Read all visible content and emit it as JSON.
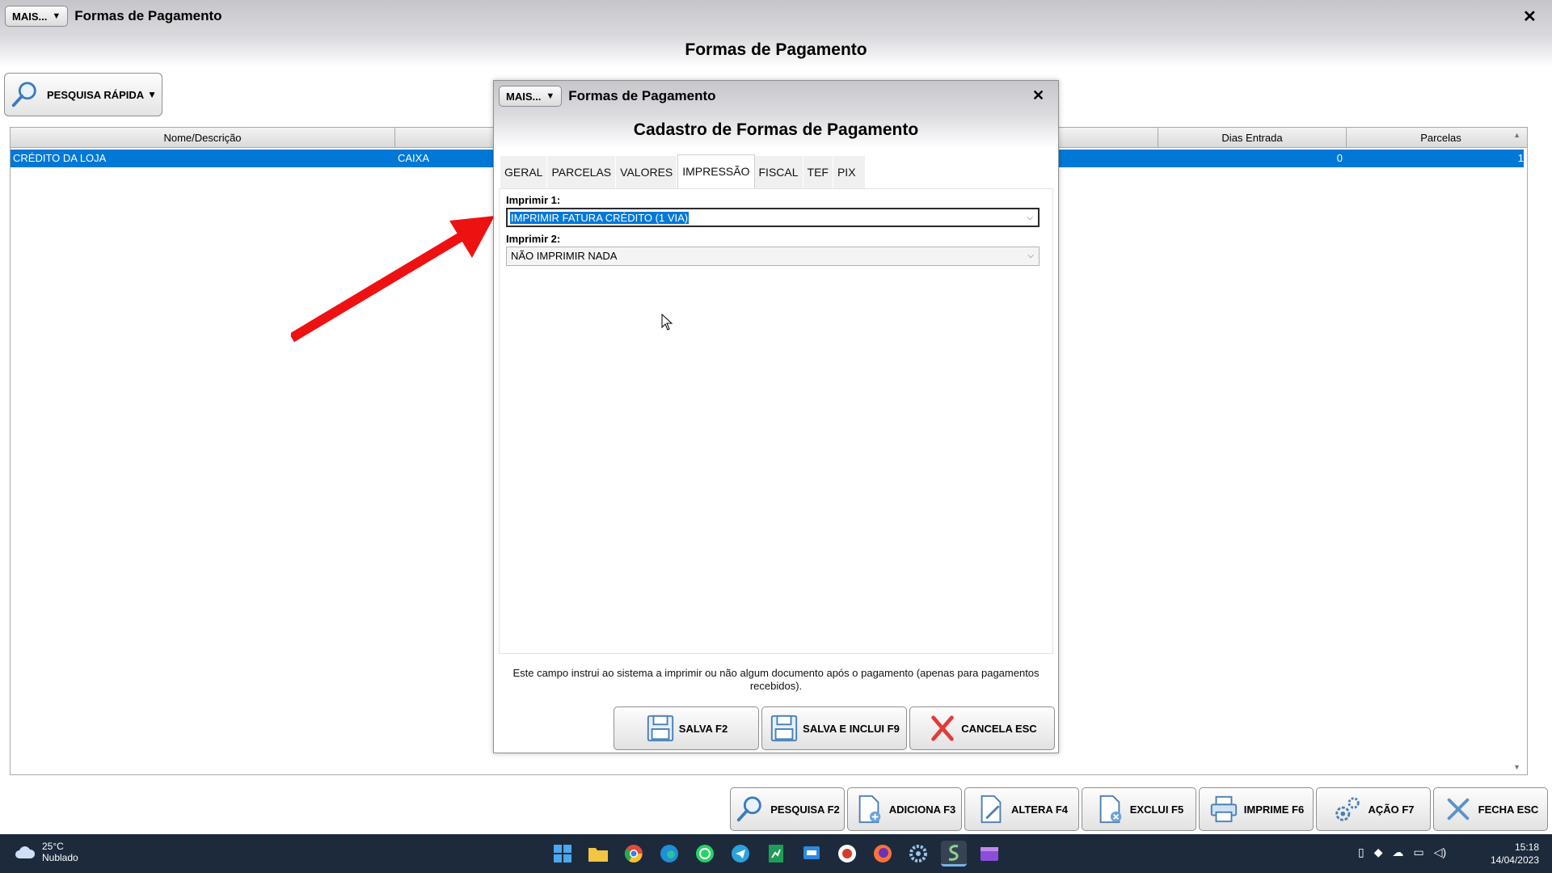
{
  "main_window": {
    "mais_label": "MAIS...",
    "title": "Formas de Pagamento",
    "header": "Formas de Pagamento",
    "quick_search_label": "PESQUISA RÁPIDA"
  },
  "grid": {
    "columns": [
      "Nome/Descrição",
      "",
      "",
      "",
      "",
      "Dias Entrada",
      "Parcelas"
    ],
    "rows": [
      {
        "nome": "CRÉDITO DA LOJA",
        "tipo": "CAIXA",
        "dias_entrada": "0",
        "parcelas": "1"
      }
    ]
  },
  "toolbar": {
    "buttons": [
      {
        "label": "PESQUISA F2",
        "icon": "search-icon"
      },
      {
        "label": "ADICIONA F3",
        "icon": "add-document-icon"
      },
      {
        "label": "ALTERA F4",
        "icon": "edit-document-icon"
      },
      {
        "label": "EXCLUI F5",
        "icon": "delete-document-icon"
      },
      {
        "label": "IMPRIME F6",
        "icon": "printer-icon"
      },
      {
        "label": "AÇÃO F7",
        "icon": "gears-icon"
      },
      {
        "label": "FECHA ESC",
        "icon": "close-icon"
      }
    ]
  },
  "dialog": {
    "mais_label": "MAIS...",
    "title": "Formas de Pagamento",
    "header": "Cadastro de Formas de Pagamento",
    "tabs": [
      "GERAL",
      "PARCELAS",
      "VALORES",
      "IMPRESSÃO",
      "FISCAL",
      "TEF",
      "PIX"
    ],
    "active_tab": "IMPRESSÃO",
    "imprimir1_label": "Imprimir 1:",
    "imprimir1_value": "IMPRIMIR FATURA CRÉDITO (1 VIA)",
    "imprimir2_label": "Imprimir 2:",
    "imprimir2_value": "NÃO IMPRIMIR NADA",
    "hint": "Este campo instrui ao sistema a imprimir ou não algum documento após o pagamento (apenas para pagamentos recebidos).",
    "buttons": {
      "save": "SALVA F2",
      "save_add": "SALVA E INCLUI F9",
      "cancel": "CANCELA ESC"
    },
    "accent_color": "#0078d7",
    "annotation_arrow_color": "#ee1111"
  },
  "taskbar": {
    "temperature": "25°C",
    "weather": "Nublado",
    "time": "15:18",
    "date": "14/04/2023",
    "apps": [
      "start-icon",
      "file-explorer-icon",
      "chrome-icon",
      "edge-icon",
      "whatsapp-icon",
      "telegram-icon",
      "spreadsheet-icon",
      "remote-icon",
      "browser-icon",
      "firefox-icon",
      "settings-icon",
      "erp-app-icon",
      "video-app-icon"
    ]
  }
}
